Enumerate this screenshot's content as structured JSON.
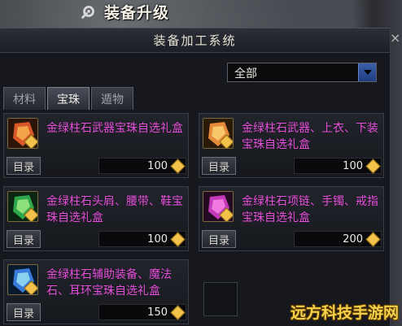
{
  "header": {
    "title": "装备升级",
    "icon": "gear-wrench-icon"
  },
  "window": {
    "title": "装备加工系统",
    "close_label": "×"
  },
  "filter": {
    "selected": "全部"
  },
  "tabs": [
    {
      "label": "材料",
      "active": false
    },
    {
      "label": "宝珠",
      "active": true
    },
    {
      "label": "遁物",
      "active": false
    }
  ],
  "items": [
    {
      "name": "金绿柱石武器宝珠自选礼盒",
      "button": "目录",
      "price": "100",
      "icon_color": "#d8562a"
    },
    {
      "name": "金绿柱石武器、上衣、下装宝珠自选礼盒",
      "button": "目录",
      "price": "100",
      "icon_color": "#e48a3a"
    },
    {
      "name": "金绿柱石头肩、腰带、鞋宝珠自选礼盒",
      "button": "目录",
      "price": "100",
      "icon_color": "#2ea84a"
    },
    {
      "name": "金绿柱石项链、手镯、戒指宝珠自选礼盒",
      "button": "目录",
      "price": "200",
      "icon_color": "#c23ab8"
    },
    {
      "name": "金绿柱石辅助装备、魔法石、耳环宝珠自选礼盒",
      "button": "目录",
      "price": "150",
      "icon_color": "#3a7ad8"
    }
  ],
  "watermark": "远方科技手游网",
  "colors": {
    "item_name": "#e254d8",
    "currency": "#f2c24a"
  }
}
